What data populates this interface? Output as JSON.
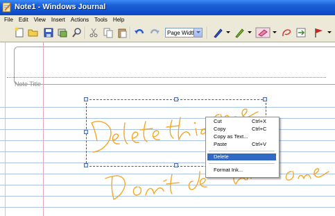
{
  "window": {
    "title": "Note1 - Windows Journal"
  },
  "menu": [
    "File",
    "Edit",
    "View",
    "Insert",
    "Actions",
    "Tools",
    "Help"
  ],
  "toolbar": {
    "icons": [
      "new-note-icon",
      "open-folder-icon",
      "save-icon",
      "import-icon",
      "find-icon",
      "cut-icon",
      "copy-icon",
      "paste-icon",
      "undo-icon",
      "redo-icon",
      "pen-icon",
      "highlighter-icon",
      "eraser-icon",
      "selection-tool-icon",
      "insert-space-icon",
      "flag-icon"
    ],
    "zoom_value": "Page Width"
  },
  "note": {
    "title_label": "Note Title",
    "ink_color": "#f5a623",
    "ink_lines": [
      "Delete this one",
      "Don't delete this one"
    ]
  },
  "context_menu": {
    "items": [
      {
        "label": "Cut",
        "shortcut": "Ctrl+X"
      },
      {
        "label": "Copy",
        "shortcut": "Ctrl+C"
      },
      {
        "label": "Copy as Text...",
        "shortcut": ""
      },
      {
        "label": "Paste",
        "shortcut": "Ctrl+V"
      },
      {
        "label": "Delete",
        "shortcut": "",
        "highlighted": true
      },
      {
        "label": "Format Ink...",
        "shortcut": ""
      }
    ]
  },
  "colors": {
    "titlebar": "#0a47c8",
    "menu_highlight": "#316ac5",
    "rule_line": "#a8c3ec",
    "margin_line": "#e0a3b8"
  }
}
